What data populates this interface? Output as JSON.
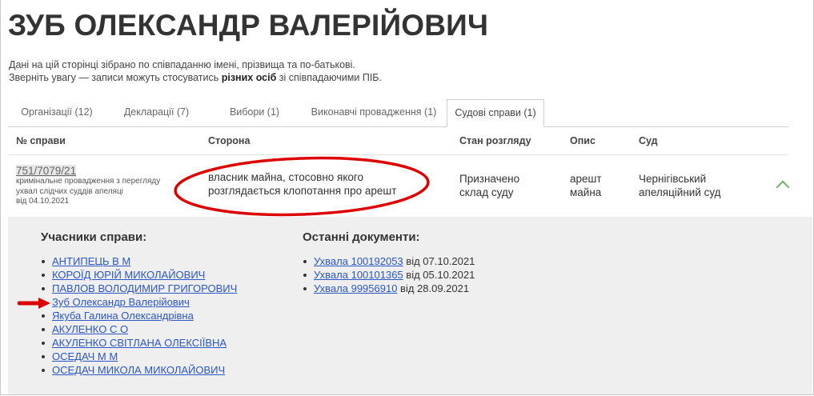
{
  "page": {
    "title": "ЗУБ ОЛЕКСАНДР ВАЛЕРІЙОВИЧ",
    "intro_line1": "Дані на цій сторінці зібрано по співпаданню імені, прізвища та по-батькові.",
    "intro_line2_before": "Зверніть увагу — записи можуть стосуватись ",
    "intro_line2_bold": "різних осіб",
    "intro_line2_after": " зі співпадаючими ПІБ."
  },
  "tabs": [
    {
      "label": "Організації (12)",
      "active": false
    },
    {
      "label": "Декларації (7)",
      "active": false
    },
    {
      "label": "Вибори (1)",
      "active": false
    },
    {
      "label": "Виконавчі провадження (1)",
      "active": false
    },
    {
      "label": "Судові справи (1)",
      "active": true
    }
  ],
  "table": {
    "headers": {
      "case_no": "№ справи",
      "party": "Сторона",
      "status": "Стан розгляду",
      "description": "Опис",
      "court": "Суд"
    },
    "row": {
      "case_no": "751/7079/21",
      "case_desc_1": "кримінальне провадження з перегляду",
      "case_desc_2": "ухвал слідчих суддів апеляці",
      "case_desc_3": "від 04.10.2021",
      "party_1": "власник майна, стосовно якого",
      "party_2": "розглядається клопотання про арешт",
      "status_1": "Призначено",
      "status_2": "склад суду",
      "description_1": "арешт",
      "description_2": "майна",
      "court_1": "Чернігівський",
      "court_2": "апеляційний суд",
      "expand_icon": "chevron-up-icon"
    }
  },
  "details": {
    "participants_title": "Учасники справи:",
    "participants": [
      "АНТИПЕЦЬ В М",
      "КОРОЇД ЮРІЙ МИКОЛАЙОВИЧ",
      "ПАВЛОВ ВОЛОДИМИР ГРИГОРОВИЧ",
      "Зуб Олександр Валерійович",
      "Якуба Галина Олександрівна",
      "АКУЛЕНКО С О",
      "АКУЛЕНКО СВІТЛАНА ОЛЕКСІЇВНА",
      "ОСЕДАЧ М М",
      "ОСЕДАЧ МИКОЛА МИКОЛАЙОВИЧ"
    ],
    "documents_title": "Останні документи:",
    "documents": [
      {
        "link": "Ухвала 100192053",
        "date": " від 07.10.2021"
      },
      {
        "link": "Ухвала 100101365",
        "date": " від 05.10.2021"
      },
      {
        "link": "Ухвала 99956910",
        "date": " від 28.09.2021"
      }
    ]
  },
  "annotations": {
    "ellipse_color": "#dd0000",
    "arrow_color": "#dd0000",
    "accent": "#6db36d",
    "link_color": "#2a56c6"
  }
}
